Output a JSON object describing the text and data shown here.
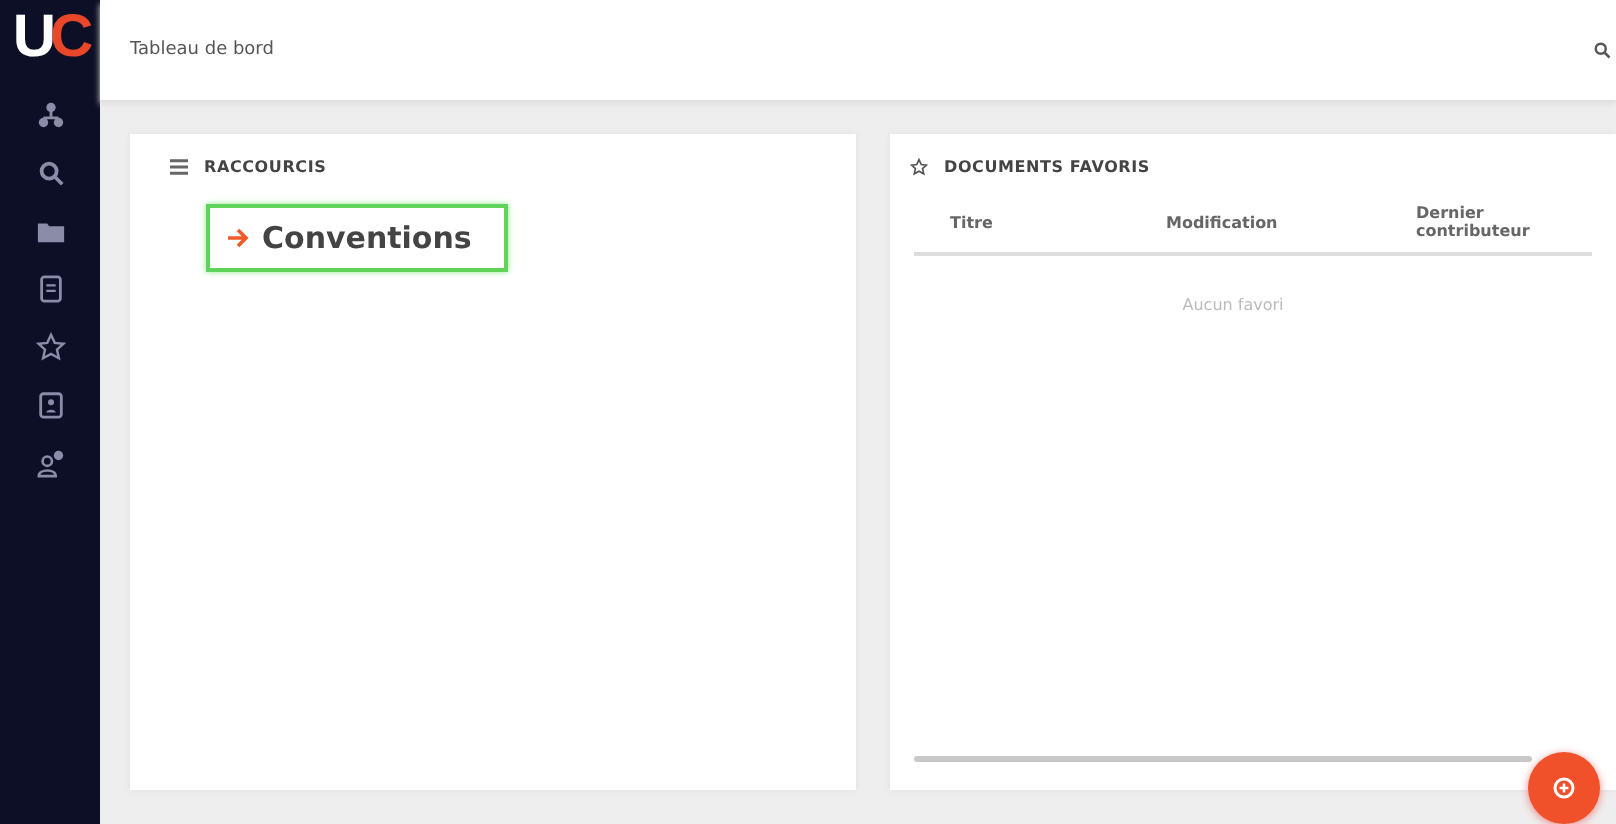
{
  "logo": {
    "first": "U",
    "second": "C"
  },
  "header": {
    "title": "Tableau de bord"
  },
  "shortcuts": {
    "title": "RACCOURCIS",
    "items": [
      {
        "label": "Conventions",
        "highlighted": true
      }
    ]
  },
  "favorites": {
    "title": "DOCUMENTS FAVORIS",
    "columns": [
      "Titre",
      "Modification",
      "Dernier contributeur"
    ],
    "empty_text": "Aucun favori"
  }
}
